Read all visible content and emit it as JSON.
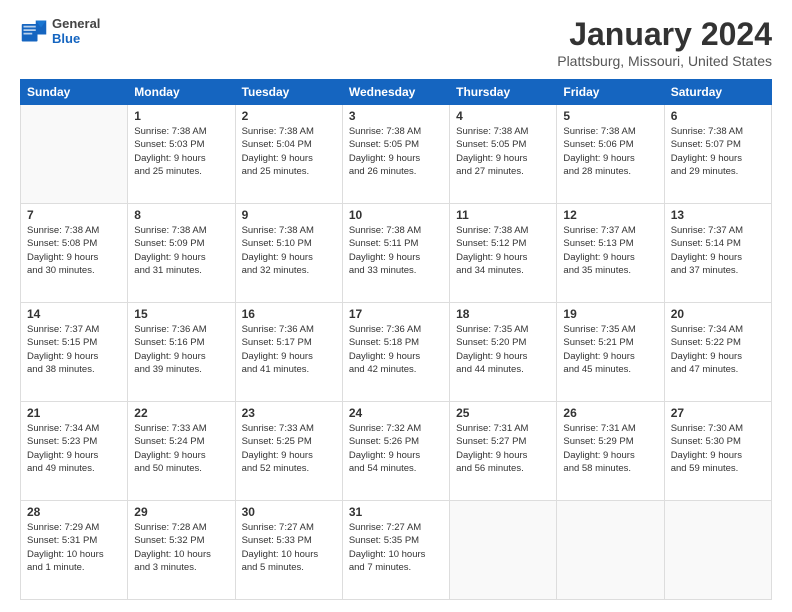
{
  "header": {
    "logo_general": "General",
    "logo_blue": "Blue",
    "month_title": "January 2024",
    "location": "Plattsburg, Missouri, United States"
  },
  "weekdays": [
    "Sunday",
    "Monday",
    "Tuesday",
    "Wednesday",
    "Thursday",
    "Friday",
    "Saturday"
  ],
  "weeks": [
    [
      {
        "day": "",
        "info": ""
      },
      {
        "day": "1",
        "info": "Sunrise: 7:38 AM\nSunset: 5:03 PM\nDaylight: 9 hours\nand 25 minutes."
      },
      {
        "day": "2",
        "info": "Sunrise: 7:38 AM\nSunset: 5:04 PM\nDaylight: 9 hours\nand 25 minutes."
      },
      {
        "day": "3",
        "info": "Sunrise: 7:38 AM\nSunset: 5:05 PM\nDaylight: 9 hours\nand 26 minutes."
      },
      {
        "day": "4",
        "info": "Sunrise: 7:38 AM\nSunset: 5:05 PM\nDaylight: 9 hours\nand 27 minutes."
      },
      {
        "day": "5",
        "info": "Sunrise: 7:38 AM\nSunset: 5:06 PM\nDaylight: 9 hours\nand 28 minutes."
      },
      {
        "day": "6",
        "info": "Sunrise: 7:38 AM\nSunset: 5:07 PM\nDaylight: 9 hours\nand 29 minutes."
      }
    ],
    [
      {
        "day": "7",
        "info": "Sunrise: 7:38 AM\nSunset: 5:08 PM\nDaylight: 9 hours\nand 30 minutes."
      },
      {
        "day": "8",
        "info": "Sunrise: 7:38 AM\nSunset: 5:09 PM\nDaylight: 9 hours\nand 31 minutes."
      },
      {
        "day": "9",
        "info": "Sunrise: 7:38 AM\nSunset: 5:10 PM\nDaylight: 9 hours\nand 32 minutes."
      },
      {
        "day": "10",
        "info": "Sunrise: 7:38 AM\nSunset: 5:11 PM\nDaylight: 9 hours\nand 33 minutes."
      },
      {
        "day": "11",
        "info": "Sunrise: 7:38 AM\nSunset: 5:12 PM\nDaylight: 9 hours\nand 34 minutes."
      },
      {
        "day": "12",
        "info": "Sunrise: 7:37 AM\nSunset: 5:13 PM\nDaylight: 9 hours\nand 35 minutes."
      },
      {
        "day": "13",
        "info": "Sunrise: 7:37 AM\nSunset: 5:14 PM\nDaylight: 9 hours\nand 37 minutes."
      }
    ],
    [
      {
        "day": "14",
        "info": "Sunrise: 7:37 AM\nSunset: 5:15 PM\nDaylight: 9 hours\nand 38 minutes."
      },
      {
        "day": "15",
        "info": "Sunrise: 7:36 AM\nSunset: 5:16 PM\nDaylight: 9 hours\nand 39 minutes."
      },
      {
        "day": "16",
        "info": "Sunrise: 7:36 AM\nSunset: 5:17 PM\nDaylight: 9 hours\nand 41 minutes."
      },
      {
        "day": "17",
        "info": "Sunrise: 7:36 AM\nSunset: 5:18 PM\nDaylight: 9 hours\nand 42 minutes."
      },
      {
        "day": "18",
        "info": "Sunrise: 7:35 AM\nSunset: 5:20 PM\nDaylight: 9 hours\nand 44 minutes."
      },
      {
        "day": "19",
        "info": "Sunrise: 7:35 AM\nSunset: 5:21 PM\nDaylight: 9 hours\nand 45 minutes."
      },
      {
        "day": "20",
        "info": "Sunrise: 7:34 AM\nSunset: 5:22 PM\nDaylight: 9 hours\nand 47 minutes."
      }
    ],
    [
      {
        "day": "21",
        "info": "Sunrise: 7:34 AM\nSunset: 5:23 PM\nDaylight: 9 hours\nand 49 minutes."
      },
      {
        "day": "22",
        "info": "Sunrise: 7:33 AM\nSunset: 5:24 PM\nDaylight: 9 hours\nand 50 minutes."
      },
      {
        "day": "23",
        "info": "Sunrise: 7:33 AM\nSunset: 5:25 PM\nDaylight: 9 hours\nand 52 minutes."
      },
      {
        "day": "24",
        "info": "Sunrise: 7:32 AM\nSunset: 5:26 PM\nDaylight: 9 hours\nand 54 minutes."
      },
      {
        "day": "25",
        "info": "Sunrise: 7:31 AM\nSunset: 5:27 PM\nDaylight: 9 hours\nand 56 minutes."
      },
      {
        "day": "26",
        "info": "Sunrise: 7:31 AM\nSunset: 5:29 PM\nDaylight: 9 hours\nand 58 minutes."
      },
      {
        "day": "27",
        "info": "Sunrise: 7:30 AM\nSunset: 5:30 PM\nDaylight: 9 hours\nand 59 minutes."
      }
    ],
    [
      {
        "day": "28",
        "info": "Sunrise: 7:29 AM\nSunset: 5:31 PM\nDaylight: 10 hours\nand 1 minute."
      },
      {
        "day": "29",
        "info": "Sunrise: 7:28 AM\nSunset: 5:32 PM\nDaylight: 10 hours\nand 3 minutes."
      },
      {
        "day": "30",
        "info": "Sunrise: 7:27 AM\nSunset: 5:33 PM\nDaylight: 10 hours\nand 5 minutes."
      },
      {
        "day": "31",
        "info": "Sunrise: 7:27 AM\nSunset: 5:35 PM\nDaylight: 10 hours\nand 7 minutes."
      },
      {
        "day": "",
        "info": ""
      },
      {
        "day": "",
        "info": ""
      },
      {
        "day": "",
        "info": ""
      }
    ]
  ]
}
